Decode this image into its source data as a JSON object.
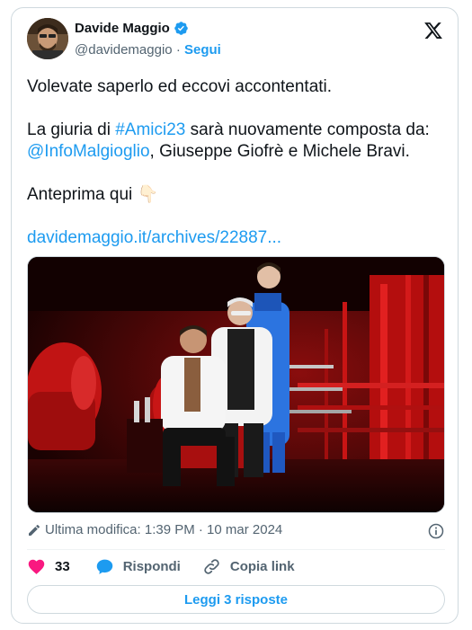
{
  "author": {
    "name": "Davide Maggio",
    "handle": "@davidemaggio",
    "separator": "·",
    "follow_label": "Segui"
  },
  "tweet": {
    "line1": "Volevate saperlo ed eccovi accontentati.",
    "line2_prefix": "La giuria di ",
    "hashtag": "#Amici23",
    "line2_suffix": " sarà nuovamente composta da:",
    "mention": "@InfoMalgioglio",
    "line3_suffix": ", Giuseppe Giofrè e Michele Bravi.",
    "preview_text": "Anteprima qui ",
    "preview_emoji": "👇🏻",
    "link": "davidemaggio.it/archives/22887..."
  },
  "meta": {
    "edited_label": "Ultima modifica: 1:39 PM · 10 mar 2024"
  },
  "actions": {
    "likes": "33",
    "reply_label": "Rispondi",
    "copy_label": "Copia link",
    "read_replies_label": "Leggi 3 risposte"
  },
  "colors": {
    "accent": "#1d9bf0",
    "like": "#f91880",
    "text": "#0f1419",
    "muted": "#536471"
  },
  "icons": [
    "verified-badge-icon",
    "x-logo-icon",
    "pencil-icon",
    "info-icon",
    "heart-icon",
    "reply-bubble-icon",
    "link-icon"
  ]
}
